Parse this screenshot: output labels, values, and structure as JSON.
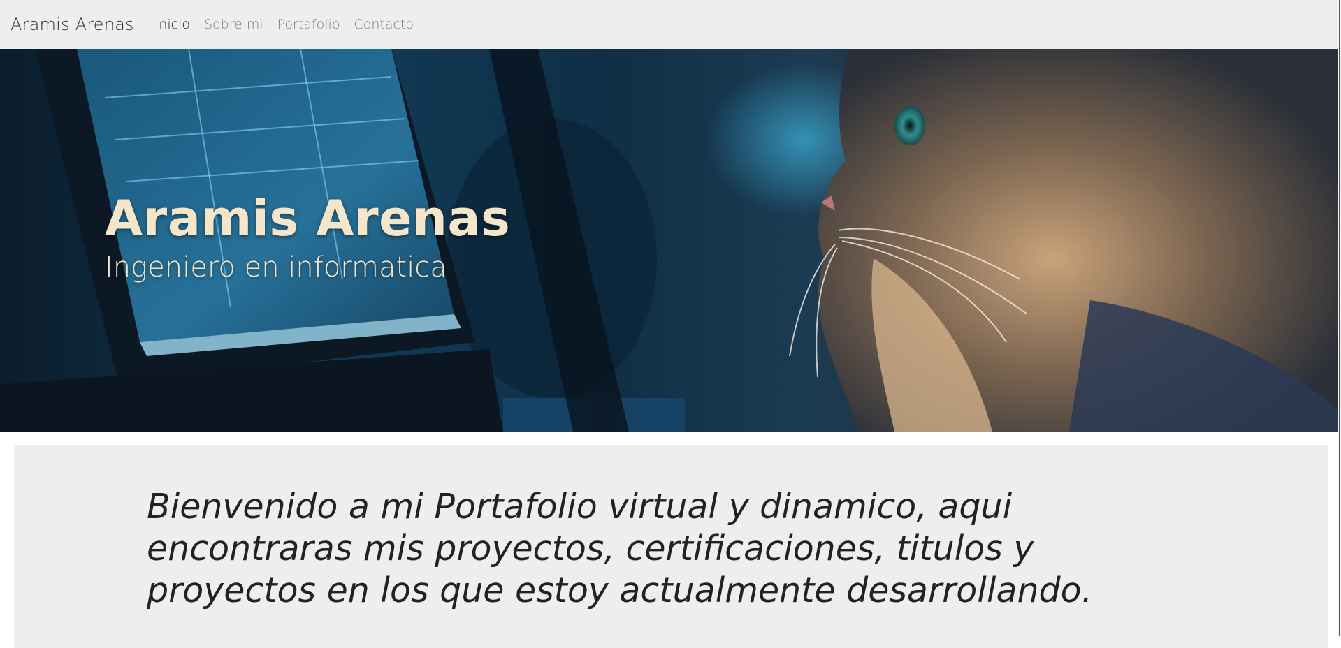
{
  "navbar": {
    "brand": "Aramis Arenas",
    "links": [
      {
        "label": "Inicio",
        "active": true
      },
      {
        "label": "Sobre mi",
        "active": false
      },
      {
        "label": "Portafolio",
        "active": false
      },
      {
        "label": "Contacto",
        "active": false
      }
    ]
  },
  "hero": {
    "title": "Aramis Arenas",
    "subtitle": "Ingeniero en informatica",
    "image_description_icon": "cat-at-computer-image"
  },
  "welcome": {
    "text": "Bienvenido a mi Portafolio virtual y dinamico, aqui encontraras mis proyectos, certificaciones, titulos y proyectos en los que estoy actualmente desarrollando."
  },
  "colors": {
    "navbar_bg": "#eeeeee",
    "hero_text": "#f6e6c9",
    "welcome_bg": "#eeeeee",
    "active_link": "#222222",
    "inactive_link": "#7a7a7a"
  }
}
